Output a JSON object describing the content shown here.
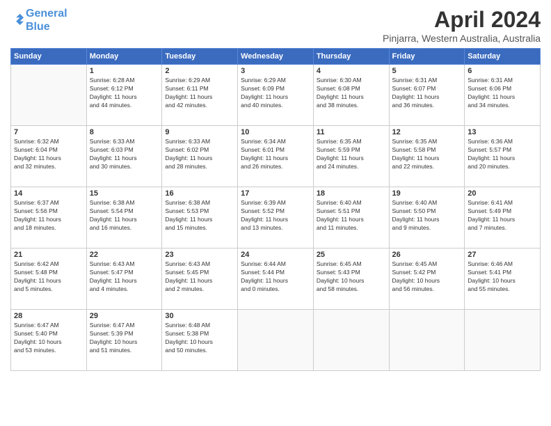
{
  "logo": {
    "line1": "General",
    "line2": "Blue"
  },
  "title": "April 2024",
  "subtitle": "Pinjarra, Western Australia, Australia",
  "weekdays": [
    "Sunday",
    "Monday",
    "Tuesday",
    "Wednesday",
    "Thursday",
    "Friday",
    "Saturday"
  ],
  "weeks": [
    [
      {
        "day": "",
        "info": ""
      },
      {
        "day": "1",
        "info": "Sunrise: 6:28 AM\nSunset: 6:12 PM\nDaylight: 11 hours\nand 44 minutes."
      },
      {
        "day": "2",
        "info": "Sunrise: 6:29 AM\nSunset: 6:11 PM\nDaylight: 11 hours\nand 42 minutes."
      },
      {
        "day": "3",
        "info": "Sunrise: 6:29 AM\nSunset: 6:09 PM\nDaylight: 11 hours\nand 40 minutes."
      },
      {
        "day": "4",
        "info": "Sunrise: 6:30 AM\nSunset: 6:08 PM\nDaylight: 11 hours\nand 38 minutes."
      },
      {
        "day": "5",
        "info": "Sunrise: 6:31 AM\nSunset: 6:07 PM\nDaylight: 11 hours\nand 36 minutes."
      },
      {
        "day": "6",
        "info": "Sunrise: 6:31 AM\nSunset: 6:06 PM\nDaylight: 11 hours\nand 34 minutes."
      }
    ],
    [
      {
        "day": "7",
        "info": "Sunrise: 6:32 AM\nSunset: 6:04 PM\nDaylight: 11 hours\nand 32 minutes."
      },
      {
        "day": "8",
        "info": "Sunrise: 6:33 AM\nSunset: 6:03 PM\nDaylight: 11 hours\nand 30 minutes."
      },
      {
        "day": "9",
        "info": "Sunrise: 6:33 AM\nSunset: 6:02 PM\nDaylight: 11 hours\nand 28 minutes."
      },
      {
        "day": "10",
        "info": "Sunrise: 6:34 AM\nSunset: 6:01 PM\nDaylight: 11 hours\nand 26 minutes."
      },
      {
        "day": "11",
        "info": "Sunrise: 6:35 AM\nSunset: 5:59 PM\nDaylight: 11 hours\nand 24 minutes."
      },
      {
        "day": "12",
        "info": "Sunrise: 6:35 AM\nSunset: 5:58 PM\nDaylight: 11 hours\nand 22 minutes."
      },
      {
        "day": "13",
        "info": "Sunrise: 6:36 AM\nSunset: 5:57 PM\nDaylight: 11 hours\nand 20 minutes."
      }
    ],
    [
      {
        "day": "14",
        "info": "Sunrise: 6:37 AM\nSunset: 5:56 PM\nDaylight: 11 hours\nand 18 minutes."
      },
      {
        "day": "15",
        "info": "Sunrise: 6:38 AM\nSunset: 5:54 PM\nDaylight: 11 hours\nand 16 minutes."
      },
      {
        "day": "16",
        "info": "Sunrise: 6:38 AM\nSunset: 5:53 PM\nDaylight: 11 hours\nand 15 minutes."
      },
      {
        "day": "17",
        "info": "Sunrise: 6:39 AM\nSunset: 5:52 PM\nDaylight: 11 hours\nand 13 minutes."
      },
      {
        "day": "18",
        "info": "Sunrise: 6:40 AM\nSunset: 5:51 PM\nDaylight: 11 hours\nand 11 minutes."
      },
      {
        "day": "19",
        "info": "Sunrise: 6:40 AM\nSunset: 5:50 PM\nDaylight: 11 hours\nand 9 minutes."
      },
      {
        "day": "20",
        "info": "Sunrise: 6:41 AM\nSunset: 5:49 PM\nDaylight: 11 hours\nand 7 minutes."
      }
    ],
    [
      {
        "day": "21",
        "info": "Sunrise: 6:42 AM\nSunset: 5:48 PM\nDaylight: 11 hours\nand 5 minutes."
      },
      {
        "day": "22",
        "info": "Sunrise: 6:43 AM\nSunset: 5:47 PM\nDaylight: 11 hours\nand 4 minutes."
      },
      {
        "day": "23",
        "info": "Sunrise: 6:43 AM\nSunset: 5:45 PM\nDaylight: 11 hours\nand 2 minutes."
      },
      {
        "day": "24",
        "info": "Sunrise: 6:44 AM\nSunset: 5:44 PM\nDaylight: 11 hours\nand 0 minutes."
      },
      {
        "day": "25",
        "info": "Sunrise: 6:45 AM\nSunset: 5:43 PM\nDaylight: 10 hours\nand 58 minutes."
      },
      {
        "day": "26",
        "info": "Sunrise: 6:45 AM\nSunset: 5:42 PM\nDaylight: 10 hours\nand 56 minutes."
      },
      {
        "day": "27",
        "info": "Sunrise: 6:46 AM\nSunset: 5:41 PM\nDaylight: 10 hours\nand 55 minutes."
      }
    ],
    [
      {
        "day": "28",
        "info": "Sunrise: 6:47 AM\nSunset: 5:40 PM\nDaylight: 10 hours\nand 53 minutes."
      },
      {
        "day": "29",
        "info": "Sunrise: 6:47 AM\nSunset: 5:39 PM\nDaylight: 10 hours\nand 51 minutes."
      },
      {
        "day": "30",
        "info": "Sunrise: 6:48 AM\nSunset: 5:38 PM\nDaylight: 10 hours\nand 50 minutes."
      },
      {
        "day": "",
        "info": ""
      },
      {
        "day": "",
        "info": ""
      },
      {
        "day": "",
        "info": ""
      },
      {
        "day": "",
        "info": ""
      }
    ]
  ]
}
